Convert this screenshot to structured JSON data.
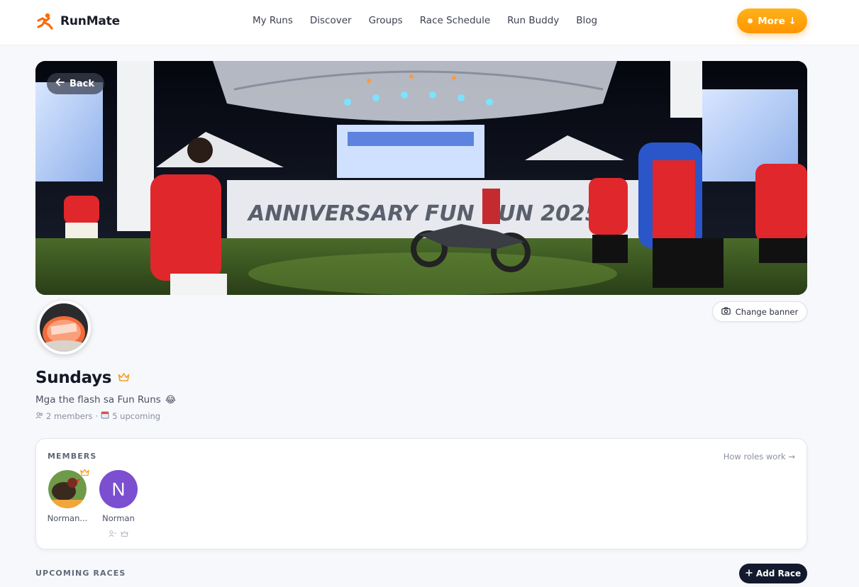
{
  "brand": {
    "name": "RunMate",
    "accent": "#ff8a00"
  },
  "nav": {
    "items": [
      {
        "label": "My Runs"
      },
      {
        "label": "Discover"
      },
      {
        "label": "Groups"
      },
      {
        "label": "Race Schedule"
      },
      {
        "label": "Run Buddy"
      },
      {
        "label": "Blog"
      }
    ],
    "more_label": "More ↓"
  },
  "banner": {
    "back_label": "Back",
    "change_label": "Change banner",
    "stage_text": "ANNIVERSARY FUN RUN 2025"
  },
  "group": {
    "name": "Sundays",
    "owner_icon": "crown-icon",
    "description": "Mga the flash sa Fun Runs",
    "description_emoji": "😂",
    "members_count": "2 members",
    "separator": "·",
    "upcoming_count": "5 upcoming"
  },
  "members_section": {
    "heading": "MEMBERS",
    "roles_link": "How roles work →",
    "members": [
      {
        "name": "Norman...",
        "avatar": "photo",
        "is_owner": true
      },
      {
        "name": "Norman",
        "avatar_letter": "N",
        "avatar_color": "#7b4fd0",
        "is_owner": false
      }
    ]
  },
  "upcoming": {
    "heading": "UPCOMING RACES",
    "add_label": "Add Race"
  }
}
